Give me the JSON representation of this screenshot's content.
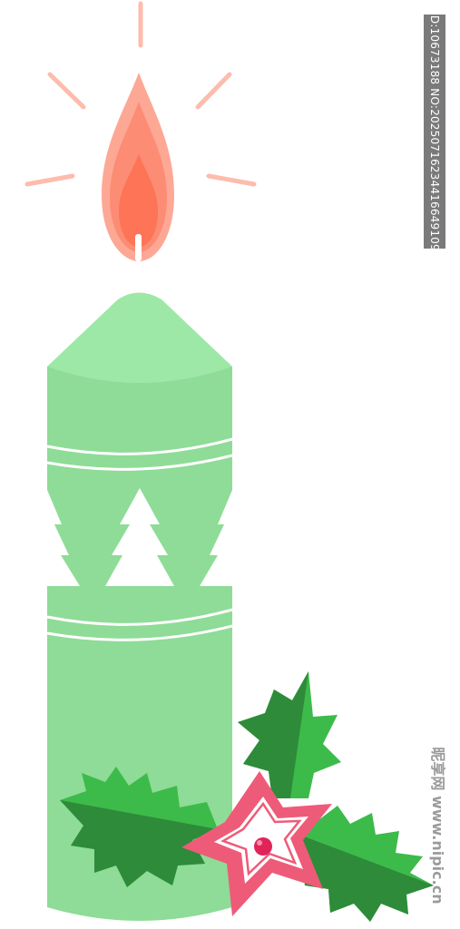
{
  "image": {
    "subject": "green christmas candle",
    "colors": {
      "background": "#ffffff",
      "candle_body": "#8edc97",
      "candle_top": "#9de8a6",
      "decor_white": "#ffffff",
      "flame_outer": "#fda895",
      "flame_inner": "#fd7a5f",
      "rays": "#fdbcac",
      "holly_dark": "#2e8b3a",
      "holly_light": "#3dbb4a",
      "star_outer": "#ee5b78",
      "star_inner": "#ffffff",
      "berry": "#e0245a"
    }
  },
  "watermark": {
    "id_text": "ID:10673188 NO:20250716234416649109",
    "site_text": "昵享网 www.nipic.cn"
  }
}
